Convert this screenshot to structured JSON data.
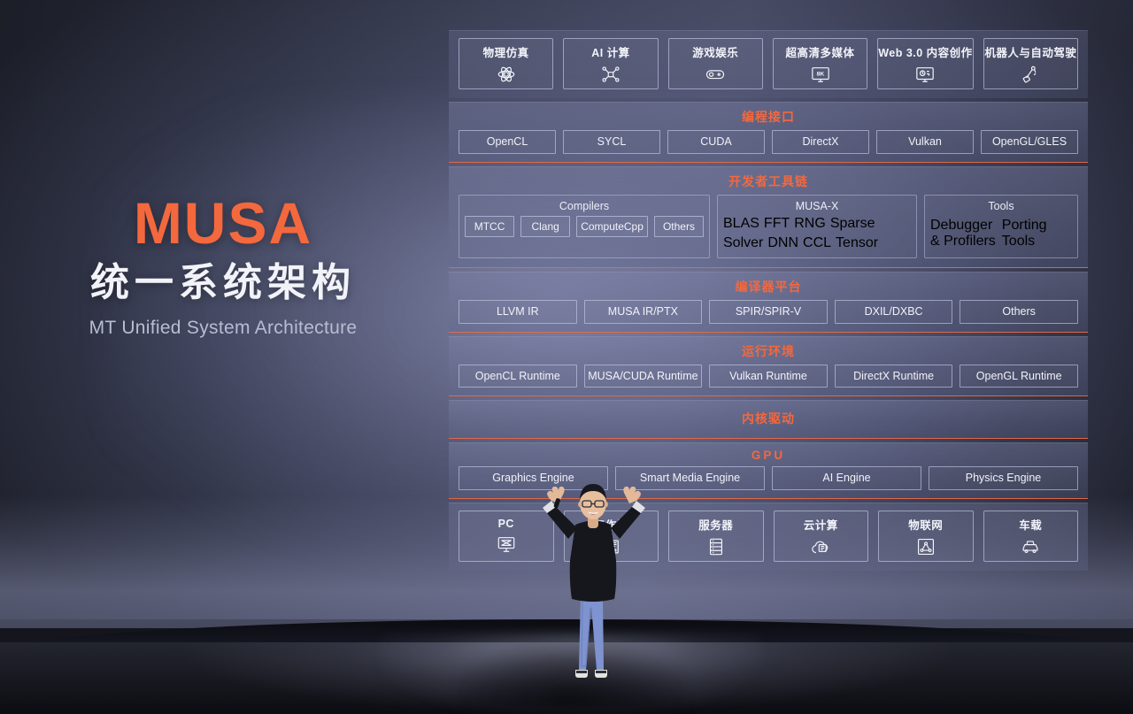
{
  "title_block": {
    "brand": "MUSA",
    "cn_title": "统一系统架构",
    "en_title": "MT Unified System Architecture"
  },
  "colors": {
    "accent": "#f4683d",
    "band_border": "#ec6842",
    "text": "#f1f2f8",
    "wall": "#3a3d50"
  },
  "diagram": {
    "top_applications": {
      "items": [
        {
          "label": "物理仿真",
          "icon": "atom-icon"
        },
        {
          "label": "AI 计算",
          "icon": "neural-network-icon"
        },
        {
          "label": "游戏娱乐",
          "icon": "gamepad-icon"
        },
        {
          "label": "超高清多媒体",
          "icon": "monitor-8k-icon"
        },
        {
          "label": "Web 3.0 内容创作",
          "icon": "web3-content-icon"
        },
        {
          "label": "机器人与自动驾驶",
          "icon": "robot-arm-icon"
        }
      ]
    },
    "programming_interface": {
      "title": "编程接口",
      "items": [
        "OpenCL",
        "SYCL",
        "CUDA",
        "DirectX",
        "Vulkan",
        "OpenGL/GLES"
      ]
    },
    "developer_toolchain": {
      "title": "开发者工具链",
      "groups": [
        {
          "name": "Compilers",
          "items": [
            "MTCC",
            "Clang",
            "ComputeCpp",
            "Others"
          ]
        },
        {
          "name": "MUSA-X",
          "row1": [
            "BLAS",
            "FFT",
            "RNG",
            "Sparse"
          ],
          "row2": [
            "Solver",
            "DNN",
            "CCL",
            "Tensor"
          ]
        },
        {
          "name": "Tools",
          "items": [
            "Debugger\n& Profilers",
            "Porting\nTools"
          ]
        }
      ]
    },
    "compiler_platform": {
      "title": "编译器平台",
      "items": [
        "LLVM IR",
        "MUSA IR/PTX",
        "SPIR/SPIR-V",
        "DXIL/DXBC",
        "Others"
      ]
    },
    "runtime_environment": {
      "title": "运行环境",
      "items": [
        "OpenCL Runtime",
        "MUSA/CUDA Runtime",
        "Vulkan Runtime",
        "DirectX Runtime",
        "OpenGL Runtime"
      ]
    },
    "kernel_driver": {
      "title": "内核驱动"
    },
    "gpu": {
      "title": "GPU",
      "items": [
        "Graphics Engine",
        "Smart Media Engine",
        "AI Engine",
        "Physics Engine"
      ]
    },
    "bottom_targets": {
      "items": [
        {
          "label": "PC",
          "icon": "desktop-icon"
        },
        {
          "label": "工作站",
          "icon": "workstation-icon"
        },
        {
          "label": "服务器",
          "icon": "server-rack-icon"
        },
        {
          "label": "云计算",
          "icon": "cloud-compute-icon"
        },
        {
          "label": "物联网",
          "icon": "iot-network-icon"
        },
        {
          "label": "车载",
          "icon": "car-icon"
        }
      ]
    }
  }
}
